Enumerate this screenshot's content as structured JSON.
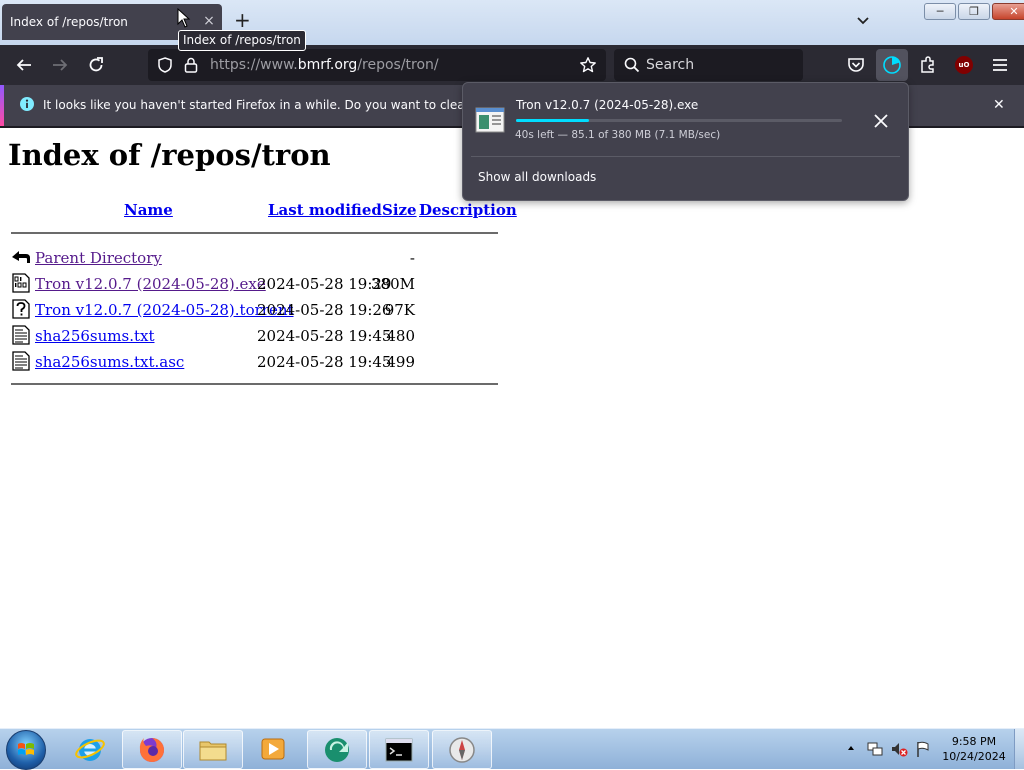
{
  "tab": {
    "title": "Index of /repos/tron",
    "close": "×",
    "new_tab": "+"
  },
  "tooltip": "Index of /repos/tron",
  "url": {
    "scheme": "https://www.",
    "host": "bmrf.org",
    "path": "/repos/tron/"
  },
  "search": {
    "placeholder": "Search"
  },
  "notification": {
    "text": "It looks like you haven't started Firefox in a while. Do you want to clean it up for"
  },
  "page": {
    "title": "Index of /repos/tron",
    "columns": {
      "name": "Name",
      "modified": "Last modified",
      "size": "Size",
      "description": "Description"
    },
    "rows": [
      {
        "name": "Parent Directory",
        "modified": "",
        "size": "-",
        "icon": "back-icon",
        "visited": true
      },
      {
        "name": "Tron v12.0.7 (2024-05-28).exe",
        "modified": "2024-05-28 19:29",
        "size": "380M",
        "icon": "binary-file-icon",
        "visited": true
      },
      {
        "name": "Tron v12.0.7 (2024-05-28).torrent",
        "modified": "2024-05-28 19:26",
        "size": "97K",
        "icon": "unknown-file-icon",
        "visited": false
      },
      {
        "name": "sha256sums.txt",
        "modified": "2024-05-28 19:45",
        "size": "480",
        "icon": "text-file-icon",
        "visited": false
      },
      {
        "name": "sha256sums.txt.asc",
        "modified": "2024-05-28 19:45",
        "size": "499",
        "icon": "text-file-icon",
        "visited": false
      }
    ]
  },
  "downloads": {
    "file_name": "Tron v12.0.7 (2024-05-28).exe",
    "status": "40s left — 85.1 of 380 MB (7.1 MB/sec)",
    "progress": 0.224,
    "show_all": "Show all downloads"
  },
  "clock": {
    "time": "9:58 PM",
    "date": "10/24/2024"
  },
  "colors": {
    "accent": "#00ddff",
    "toolbar": "#2b2a33",
    "link": "#0000ee",
    "visited": "#551a8b"
  }
}
